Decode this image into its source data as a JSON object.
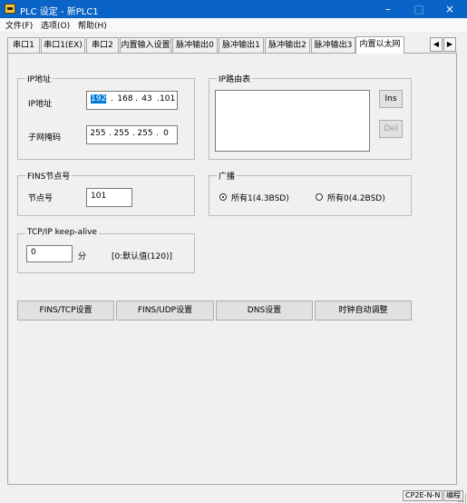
{
  "window": {
    "title": "PLC 设定 - 新PLC1",
    "minimize_glyph": "–",
    "maximize_glyph": "□",
    "close_glyph": "×"
  },
  "menu": {
    "items": [
      "文件(F)",
      "选项(O)",
      "帮助(H)"
    ]
  },
  "tabs": [
    {
      "label": "串口1"
    },
    {
      "label": "串口1(EX)"
    },
    {
      "label": "串口2"
    },
    {
      "label": "内置输入设置"
    },
    {
      "label": "脉冲输出0"
    },
    {
      "label": "脉冲输出1"
    },
    {
      "label": "脉冲输出2"
    },
    {
      "label": "脉冲输出3"
    },
    {
      "label": "内置以太网",
      "active": true
    }
  ],
  "tab_scroll": {
    "left": "◀",
    "right": "▶"
  },
  "ip_group": {
    "title": "IP地址",
    "ip_label": "IP地址",
    "ip_octets": [
      "192",
      "168",
      "43",
      "101"
    ],
    "mask_label": "子网掩码",
    "mask_octets": [
      "255",
      "255",
      "255",
      "0"
    ],
    "dot": "."
  },
  "route_group": {
    "title": "IP路由表",
    "ins_label": "Ins",
    "del_label": "Del"
  },
  "fins_group": {
    "title": "FINS节点号",
    "node_label": "节点号",
    "node_value": "101"
  },
  "broadcast_group": {
    "title": "广播",
    "option1": "所有1(4.3BSD)",
    "option2": "所有0(4.2BSD)",
    "selected": "所有1(4.3BSD)"
  },
  "keepalive_group": {
    "title": "TCP/IP keep-alive",
    "value": "0",
    "unit": "分",
    "note": "[0:默认值(120)]"
  },
  "buttons": {
    "fins_tcp": "FINS/TCP设置",
    "fins_udp": "FINS/UDP设置",
    "dns": "DNS设置",
    "clock": "时钟自动调整"
  },
  "status": {
    "model": "CP2E-N-N",
    "mode": "编程"
  },
  "colors": {
    "titlebar": "#0a64c8",
    "selection": "#0078d7"
  },
  "icons": {
    "app": "plc-app-icon"
  }
}
